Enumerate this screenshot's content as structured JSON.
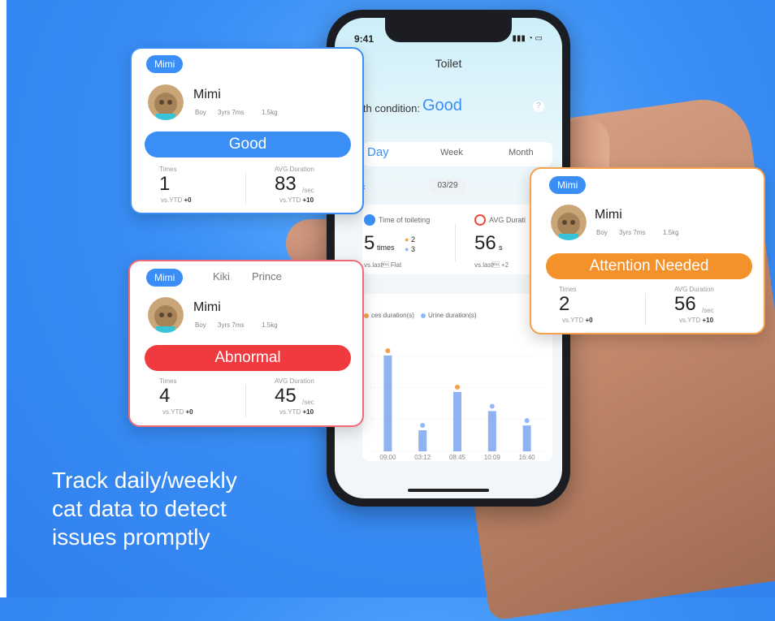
{
  "phone": {
    "status_time": "9:41",
    "title": "Toilet",
    "health_label": "lth condition:",
    "health_value": "Good",
    "tabs": [
      "Day",
      "Week",
      "Month"
    ],
    "date": "03/29",
    "toileting_label": "Time of toileting",
    "toileting_times": "5",
    "toileting_unit": "times",
    "toileting_feces": "2",
    "toileting_urine": "3",
    "toileting_vs": "vs.last\u0003 Flat",
    "avg_label": "AVG Durati",
    "avg_value": "56",
    "avg_unit": "s",
    "avg_vs": "vs.last\u0003 +2",
    "legend_feces": "ces duration(s)",
    "legend_urine": "Urine duration(s)",
    "colors": {
      "accent": "#3a8ef5",
      "bar": "#8fb2f2",
      "feces": "#f5a04a",
      "urine": "#8fb8f5"
    }
  },
  "chart_data": {
    "type": "bar",
    "categories": [
      "09:00",
      "03:12",
      "08:45",
      "10:09",
      "16:40"
    ],
    "values": [
      100,
      22,
      62,
      42,
      27
    ]
  },
  "cards": {
    "good": {
      "pill": "Mimi",
      "name": "Mimi",
      "gender": "Boy",
      "age": "3yrs 7ms",
      "weight": "1.5kg",
      "status": "Good",
      "status_color": "#3a8ef5",
      "times_label": "Times",
      "times_value": "1",
      "times_vs_prefix": "vs.YTD",
      "times_vs": "+0",
      "dur_label": "AVG Duration",
      "dur_value": "83",
      "dur_unit": "/sec",
      "dur_vs_prefix": "vs.YTD",
      "dur_vs": "+10"
    },
    "abnormal": {
      "pill": "Mimi",
      "tabs": [
        "Kiki",
        "Prince"
      ],
      "name": "Mimi",
      "gender": "Boy",
      "age": "3yrs 7ms",
      "weight": "1.5kg",
      "status": "Abnormal",
      "status_color": "#f03a3f",
      "times_label": "Times",
      "times_value": "4",
      "times_vs_prefix": "vs.YTD",
      "times_vs": "+0",
      "dur_label": "AVG Duration",
      "dur_value": "45",
      "dur_unit": "/sec",
      "dur_vs_prefix": "vs.YTD",
      "dur_vs": "+10"
    },
    "attention": {
      "pill": "Mimi",
      "name": "Mimi",
      "gender": "Boy",
      "age": "3yrs 7ms",
      "weight": "1.5kg",
      "status": "Attention Needed",
      "status_color": "#f5912a",
      "times_label": "Times",
      "times_value": "2",
      "times_vs_prefix": "vs.YTD",
      "times_vs": "+0",
      "dur_label": "AVG Duration",
      "dur_value": "56",
      "dur_unit": "/sec",
      "dur_vs_prefix": "vs.YTD",
      "dur_vs": "+10"
    }
  },
  "tagline": [
    "Track daily/weekly",
    "cat data to detect",
    "issues promptly"
  ]
}
